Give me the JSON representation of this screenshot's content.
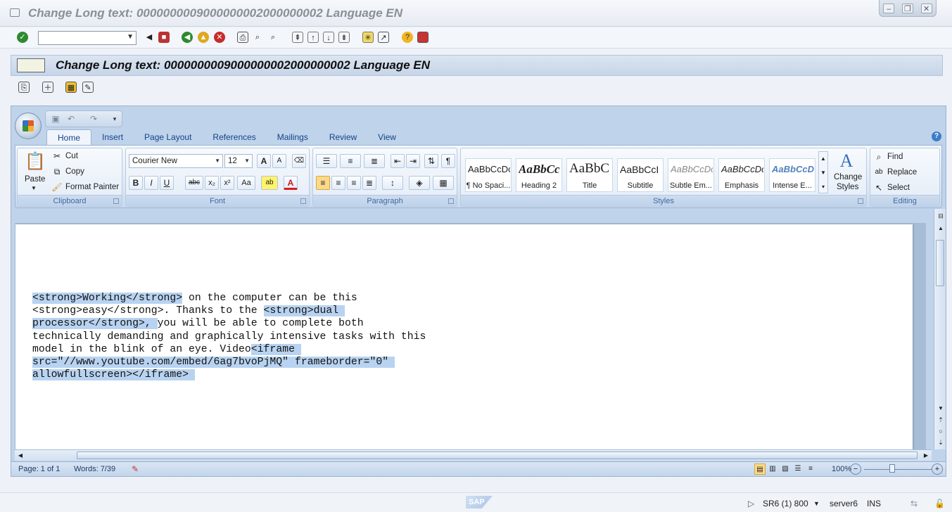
{
  "window": {
    "title": "Change Long text: 0000000009000000002000000002 Language EN",
    "controls": [
      "minimize",
      "restore",
      "close"
    ]
  },
  "system_toolbar": {
    "command_field_value": "",
    "icons": [
      "enter-icon",
      "back-icon",
      "save-icon",
      "back-nav-icon",
      "exit-icon",
      "cancel-icon",
      "print-icon",
      "find-icon",
      "find-next-icon",
      "first-page-icon",
      "prev-page-icon",
      "next-page-icon",
      "last-page-icon",
      "new-session-icon",
      "shortcut-icon",
      "help-icon",
      "layout-icon"
    ]
  },
  "screen": {
    "title": "Change Long text: 0000000009000000002000000002 Language EN"
  },
  "word": {
    "tabs": [
      "Home",
      "Insert",
      "Page Layout",
      "References",
      "Mailings",
      "Review",
      "View"
    ],
    "active_tab": "Home",
    "clipboard": {
      "group_label": "Clipboard",
      "paste": "Paste",
      "cut": "Cut",
      "copy": "Copy",
      "format_painter": "Format Painter"
    },
    "font": {
      "group_label": "Font",
      "font_name": "Courier New",
      "font_size": "12",
      "buttons": [
        "B",
        "I",
        "U",
        "abc",
        "x₂",
        "x²",
        "Aa",
        "ab",
        "A"
      ]
    },
    "paragraph": {
      "group_label": "Paragraph"
    },
    "styles": {
      "group_label": "Styles",
      "items": [
        {
          "sample": "AaBbCcDc",
          "name": "¶ No Spaci..."
        },
        {
          "sample": "AaBbCc",
          "name": "Heading 2"
        },
        {
          "sample": "AaBbC",
          "name": "Title"
        },
        {
          "sample": "AaBbCcI",
          "name": "Subtitle"
        },
        {
          "sample": "AaBbCcDc",
          "name": "Subtle Em..."
        },
        {
          "sample": "AaBbCcDc",
          "name": "Emphasis"
        },
        {
          "sample": "AaBbCcDc",
          "name": "Intense E..."
        }
      ],
      "change_styles_line1": "Change",
      "change_styles_line2": "Styles"
    },
    "editing": {
      "group_label": "Editing",
      "find": "Find",
      "replace": "Replace",
      "select": "Select"
    },
    "document": {
      "lines": [
        "<strong>Working</strong> on the computer can be this",
        "<strong>easy</strong>. Thanks to the <strong>dual",
        "processor</strong>, you will be able to complete both",
        "technically demanding and graphically intensive tasks with this",
        "model in the blink of an eye. Video<iframe",
        "src=\"//www.youtube.com/embed/6ag7bvoPjMQ\" frameborder=\"0\"",
        "allowfullscreen></iframe>"
      ],
      "highlight_color": "#b8d3f1"
    },
    "status": {
      "page": "Page: 1 of 1",
      "words": "Words: 7/39",
      "zoom": "100%"
    }
  },
  "sap_status": {
    "system": "SR6 (1) 800",
    "server": "server6",
    "mode": "INS",
    "logo": "SAP"
  }
}
